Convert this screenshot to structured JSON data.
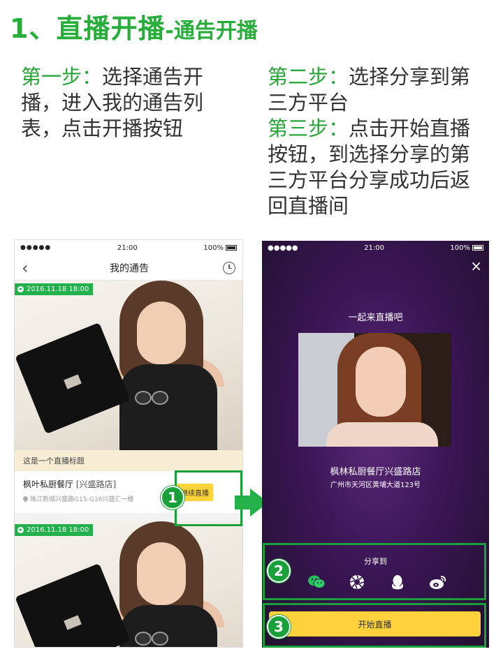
{
  "header": {
    "title_main": "1、直播开播",
    "title_sub": "-通告开播"
  },
  "instructions": {
    "left": {
      "step_label": "第一步：",
      "text": "选择通告开播，进入我的通告列表，点击开播按钮"
    },
    "right": {
      "step2_label": "第二步：",
      "step2_text": "选择分享到第三方平台",
      "step3_label": "第三步：",
      "step3_text": "点击开始直播按钮，到选择分享的第三方平台分享成功后返回直播间"
    }
  },
  "left_phone": {
    "status": {
      "signal": "●●●●● ",
      "time": "21:00",
      "battery": "100%"
    },
    "nav_title": "我的通告",
    "cards": [
      {
        "date": "2016.11.18  18:00",
        "live_title": "这是一个直播标题",
        "restaurant": "枫叶私厨餐厅",
        "branch": "[兴盛路店]",
        "address": "珠江新城兴盛路G15-G16兴盛汇一楼",
        "button": "继续直播"
      },
      {
        "date": "2016.11.18  18:00"
      }
    ]
  },
  "right_phone": {
    "status": {
      "signal": "●●●●● ",
      "time": "21:00",
      "battery": "100%"
    },
    "close_icon": "×",
    "headline": "一起来直播吧",
    "shop_name": "枫林私厨餐厅兴盛路店",
    "shop_address": "广州市天河区黄埔大道123号",
    "share_label": "分享到",
    "share_icons": [
      "wechat-icon",
      "moments-icon",
      "qq-icon",
      "weibo-icon"
    ],
    "start_button": "开始直播"
  },
  "steps": [
    "1",
    "2",
    "3"
  ],
  "colors": {
    "accent_green": "#1aa03a",
    "button_yellow": "#ffd43b",
    "purple_bg": "#3b1656"
  }
}
